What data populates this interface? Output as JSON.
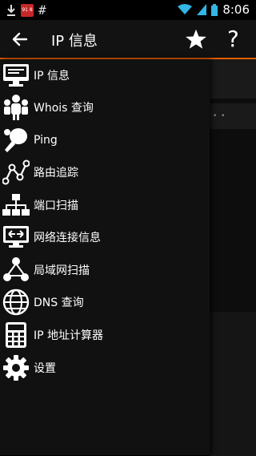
{
  "status": {
    "time": "8:06",
    "left_symbol": "#",
    "app_badge": "91 8",
    "icons": [
      "download-icon",
      "wifi-icon",
      "signal-icon",
      "battery-icon"
    ]
  },
  "appbar": {
    "title": "IP 信息",
    "back_icon": "back-arrow-icon",
    "star_icon": "star-icon",
    "help_symbol": "?"
  },
  "colors": {
    "accent": "#e65c00",
    "background": "#000000",
    "drawer": "#111111"
  },
  "drawer": {
    "items": [
      {
        "label": "IP 信息",
        "icon": "monitor-icon"
      },
      {
        "label": "Whois 查询",
        "icon": "users-icon"
      },
      {
        "label": "Ping",
        "icon": "ping-pong-icon"
      },
      {
        "label": "路由追踪",
        "icon": "route-icon"
      },
      {
        "label": "端口扫描",
        "icon": "network-tree-icon"
      },
      {
        "label": "网络连接信息",
        "icon": "connection-icon"
      },
      {
        "label": "局域网扫描",
        "icon": "lan-icon"
      },
      {
        "label": "DNS 查询",
        "icon": "globe-icon"
      },
      {
        "label": "IP 地址计算器",
        "icon": "calculator-icon"
      },
      {
        "label": "设置",
        "icon": "gear-icon"
      }
    ]
  },
  "background_content": {
    "dots": "• •"
  }
}
